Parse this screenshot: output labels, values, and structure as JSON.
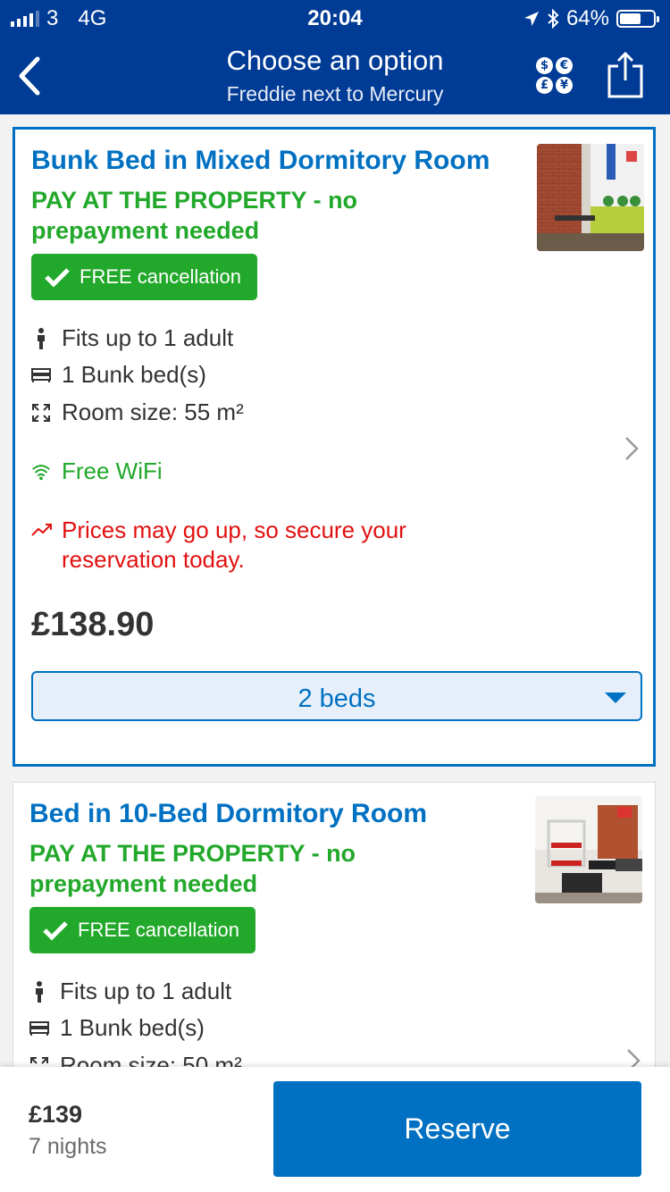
{
  "status_bar": {
    "carrier": "3",
    "network": "4G",
    "time": "20:04",
    "battery": "64%",
    "battery_level": 0.64
  },
  "nav": {
    "title": "Choose an option",
    "subtitle": "Freddie next to Mercury"
  },
  "rooms": [
    {
      "title": "Bunk Bed in Mixed Dormitory Room",
      "payment": "PAY AT THE PROPERTY - no prepayment needed",
      "cancellation": "FREE cancellation",
      "occupancy": "Fits up to 1 adult",
      "beds": "1 Bunk bed(s)",
      "size": "Room size: 55 m²",
      "wifi": "Free WiFi",
      "urgency": "Prices may go up, so secure your reservation today.",
      "price": "£138.90",
      "selection": "2 beds"
    },
    {
      "title": "Bed in 10-Bed Dormitory Room",
      "payment": "PAY AT THE PROPERTY - no prepayment needed",
      "cancellation": "FREE cancellation",
      "occupancy": "Fits up to 1 adult",
      "beds": "1 Bunk bed(s)",
      "size": "Room size: 50 m²"
    }
  ],
  "summary": {
    "price": "£139",
    "nights": "7 nights",
    "reserve_label": "Reserve"
  },
  "colors": {
    "brand": "#003b95",
    "link": "#0071c2",
    "green": "#22a82a",
    "urgency": "#e21111"
  }
}
